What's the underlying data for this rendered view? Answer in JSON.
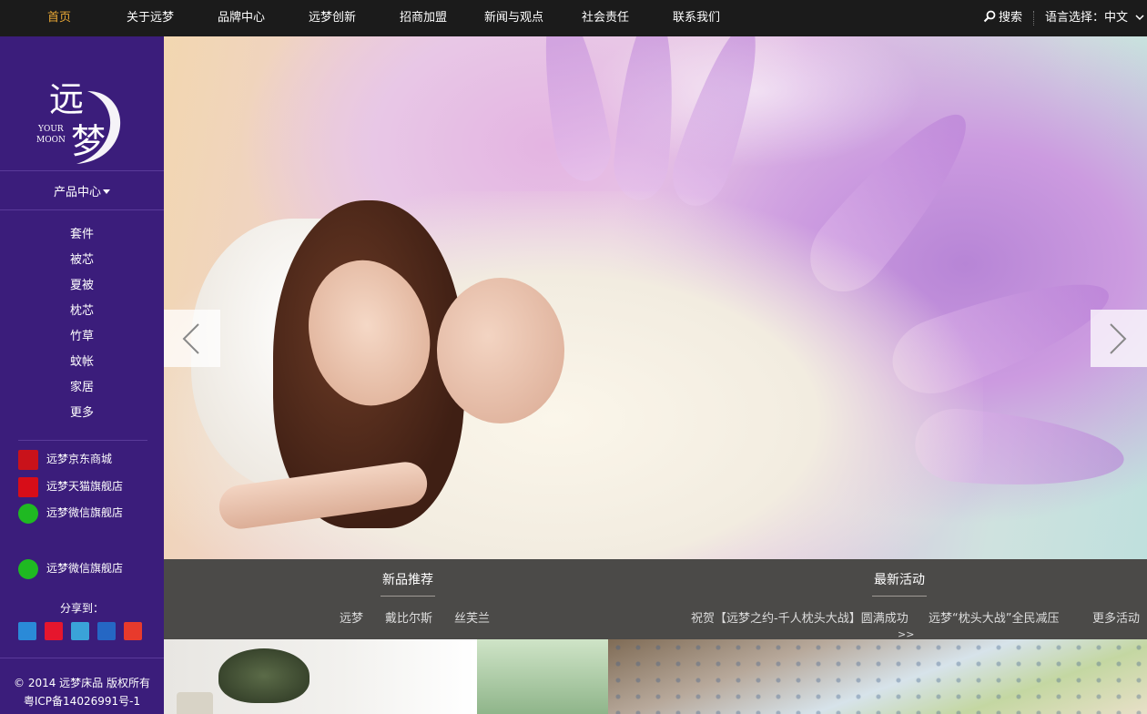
{
  "nav": {
    "items": [
      {
        "label": "首页",
        "active": true
      },
      {
        "label": "关于远梦",
        "active": false
      },
      {
        "label": "品牌中心",
        "active": false
      },
      {
        "label": "远梦创新",
        "active": false
      },
      {
        "label": "招商加盟",
        "active": false
      },
      {
        "label": "新闻与观点",
        "active": false
      },
      {
        "label": "社会责任",
        "active": false
      },
      {
        "label": "联系我们",
        "active": false
      }
    ],
    "search_label": "搜索",
    "language_label": "语言选择：中文"
  },
  "sidebar": {
    "logo": {
      "chinese": "远梦",
      "english_line1": "YOUR",
      "english_line2": "MOON"
    },
    "product_center": "产品中心",
    "categories": [
      "套件",
      "被芯",
      "夏被",
      "枕芯",
      "竹草",
      "蚊帐",
      "家居",
      "更多"
    ],
    "shops": [
      {
        "label": "远梦京东商城",
        "icon": "jd-icon"
      },
      {
        "label": "远梦天猫旗舰店",
        "icon": "tmall-icon"
      },
      {
        "label": "远梦微信旗舰店",
        "icon": "wechat-icon"
      },
      {
        "label": "远梦微信旗舰店",
        "icon": "wechat-icon"
      }
    ],
    "share_label": "分享到：",
    "share_icons": [
      "qzone-icon",
      "weibo-icon",
      "tencent-weibo-icon",
      "renren-icon",
      "favorite-icon"
    ],
    "copyright_line1": "© 2014 远梦床品 版权所有",
    "copyright_line2": "粤ICP备14026991号-1"
  },
  "band": {
    "new_products": {
      "title": "新品推荐",
      "links": [
        "远梦",
        "戴比尔斯",
        "丝芙兰"
      ]
    },
    "latest_events": {
      "title": "最新活动",
      "links": [
        "祝贺【远梦之约-千人枕头大战】圆满成功",
        "远梦“枕头大战”全民减压",
        "更多活动"
      ],
      "more_arrows": ">>"
    }
  },
  "colors": {
    "sidebar_bg": "#3b1d7b",
    "topbar_bg": "#1b1b1b",
    "nav_active": "#e8a735",
    "band_bg": "#4b4a48"
  }
}
